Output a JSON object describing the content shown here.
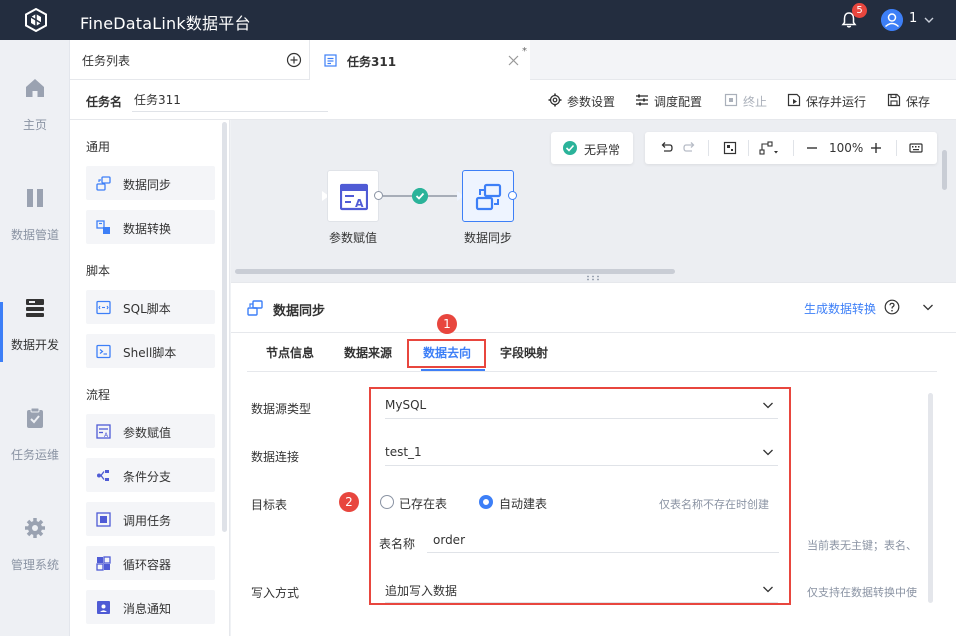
{
  "app": {
    "title": "FineDataLink数据平台",
    "notification_count": "5",
    "user_name": "1"
  },
  "nav": {
    "items": [
      {
        "label": "主页",
        "icon": "home-icon"
      },
      {
        "label": "数据管道",
        "icon": "pipeline-icon"
      },
      {
        "label": "数据开发",
        "icon": "dev-icon",
        "active": true
      },
      {
        "label": "任务运维",
        "icon": "ops-icon"
      },
      {
        "label": "管理系统",
        "icon": "gear-icon"
      }
    ]
  },
  "tasklist": {
    "title": "任务列表"
  },
  "tabs": [
    {
      "label": "任务311",
      "dirty_mark": "*"
    }
  ],
  "task": {
    "name_label": "任务名",
    "name_value": "任务311"
  },
  "toolbar": {
    "param_settings": "参数设置",
    "schedule_config": "调度配置",
    "stop": "终止",
    "save_and_run": "保存并运行",
    "save": "保存"
  },
  "components": {
    "sections": [
      {
        "title": "通用",
        "items": [
          "数据同步",
          "数据转换"
        ]
      },
      {
        "title": "脚本",
        "items": [
          "SQL脚本",
          "Shell脚本"
        ]
      },
      {
        "title": "流程",
        "items": [
          "参数赋值",
          "条件分支",
          "调用任务",
          "循环容器",
          "消息通知"
        ]
      }
    ]
  },
  "canvas": {
    "status": "无异常",
    "zoom": "100%",
    "nodes": [
      {
        "label": "参数赋值"
      },
      {
        "label": "数据同步"
      }
    ]
  },
  "detail": {
    "title": "数据同步",
    "generate_link": "生成数据转换",
    "tabs": [
      "节点信息",
      "数据来源",
      "数据去向",
      "字段映射"
    ],
    "active_tab": "数据去向",
    "markers": [
      "1",
      "2"
    ],
    "form": {
      "source_type_label": "数据源类型",
      "source_type_value": "MySQL",
      "connection_label": "数据连接",
      "connection_value": "test_1",
      "target_label": "目标表",
      "radio_existing": "已存在表",
      "radio_auto": "自动建表",
      "auto_hint": "仅表名称不存在时创建",
      "table_name_label": "表名称",
      "table_name_value": "order",
      "table_hint": "当前表无主键；表名、",
      "write_mode_label": "写入方式",
      "write_mode_value": "追加写入数据",
      "write_hint": "仅支持在数据转换中使"
    }
  },
  "colors": {
    "topbar": "#232d3f",
    "accent": "#3d7ff7",
    "highlight": "#e8463e",
    "success": "#2bb39a"
  }
}
